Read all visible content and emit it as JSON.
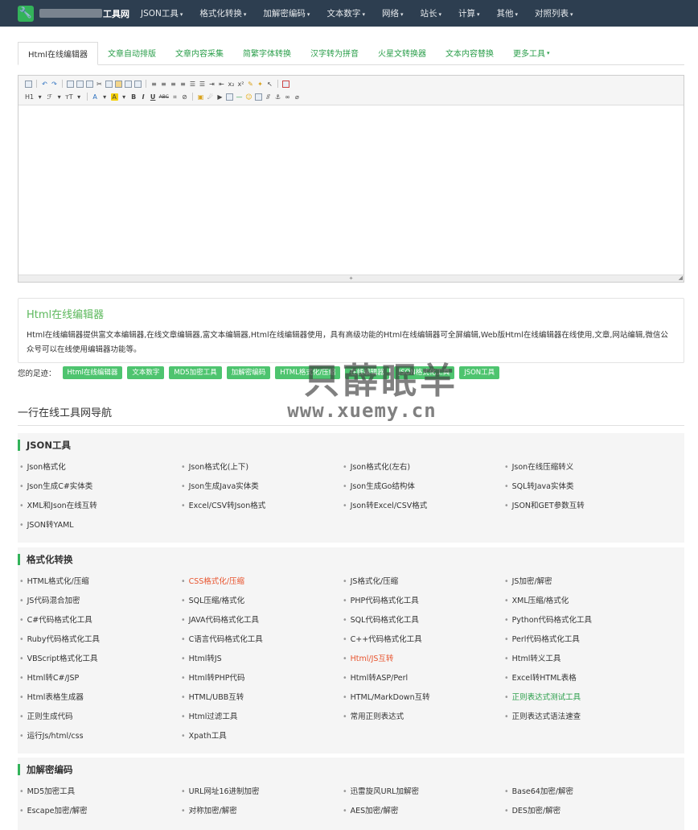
{
  "topnav": {
    "logo_icon": "wrench-icon",
    "site_name": "工具网",
    "items": [
      {
        "label": "JSON工具"
      },
      {
        "label": "格式化转换"
      },
      {
        "label": "加解密编码"
      },
      {
        "label": "文本数字"
      },
      {
        "label": "网络"
      },
      {
        "label": "站长"
      },
      {
        "label": "计算"
      },
      {
        "label": "其他"
      },
      {
        "label": "对照列表"
      }
    ]
  },
  "tabs": [
    {
      "label": "Html在线编辑器",
      "active": true
    },
    {
      "label": "文章自动排版"
    },
    {
      "label": "文章内容采集"
    },
    {
      "label": "简繁字体转换"
    },
    {
      "label": "汉字转为拼音"
    },
    {
      "label": "火星文转换器"
    },
    {
      "label": "文本内容替换"
    },
    {
      "label": "更多工具"
    }
  ],
  "editor": {
    "toolbar_row2_labels": {
      "heading": "H1",
      "font": "ℱ",
      "size": "тT",
      "bold": "B",
      "italic": "I",
      "underline": "U",
      "strike": "ABC"
    }
  },
  "description": {
    "title": "Html在线编辑器",
    "text": "Html在线编辑器提供富文本编辑器,在线文章编辑器,富文本编辑器,Html在线编辑器使用，具有高级功能的Html在线编辑器可全屏编辑,Web版Html在线编辑器在线使用,文章,网站编辑,微信公众号可以在线使用编辑器功能等。"
  },
  "footprint": {
    "label": "您的足迹：",
    "items": [
      "Html在线编辑器",
      "文本数字",
      "MD5加密工具",
      "加解密编码",
      "HTML格式化/压缩",
      "在线编辑器",
      "JSON格式化工具",
      "JSON工具"
    ]
  },
  "watermark": {
    "line1": "只薛眠羊",
    "line2": "www.xuemy.cn"
  },
  "nav_heading": "一行在线工具网导航",
  "sections": [
    {
      "title": "JSON工具",
      "items": [
        {
          "label": "Json格式化"
        },
        {
          "label": "Json格式化(上下)"
        },
        {
          "label": "Json格式化(左右)"
        },
        {
          "label": "Json在线压缩转义"
        },
        {
          "label": "Json生成C#实体类"
        },
        {
          "label": "Json生成Java实体类"
        },
        {
          "label": "Json生成Go结构体"
        },
        {
          "label": "SQL转Java实体类"
        },
        {
          "label": "XML和Json在线互转"
        },
        {
          "label": "Excel/CSV转Json格式"
        },
        {
          "label": "Json转Excel/CSV格式"
        },
        {
          "label": "JSON和GET参数互转"
        },
        {
          "label": "JSON转YAML"
        }
      ]
    },
    {
      "title": "格式化转换",
      "items": [
        {
          "label": "HTML格式化/压缩"
        },
        {
          "label": "CSS格式化/压缩",
          "color": "red"
        },
        {
          "label": "JS格式化/压缩"
        },
        {
          "label": "JS加密/解密"
        },
        {
          "label": "JS代码混合加密"
        },
        {
          "label": "SQL压缩/格式化"
        },
        {
          "label": "PHP代码格式化工具"
        },
        {
          "label": "XML压缩/格式化"
        },
        {
          "label": "C#代码格式化工具"
        },
        {
          "label": "JAVA代码格式化工具"
        },
        {
          "label": "SQL代码格式化工具"
        },
        {
          "label": "Python代码格式化工具"
        },
        {
          "label": "Ruby代码格式化工具"
        },
        {
          "label": "C语言代码格式化工具"
        },
        {
          "label": "C++代码格式化工具"
        },
        {
          "label": "Perl代码格式化工具"
        },
        {
          "label": "VBScript格式化工具"
        },
        {
          "label": "Html转JS"
        },
        {
          "label": "Html/JS互转",
          "color": "red"
        },
        {
          "label": "Html转义工具"
        },
        {
          "label": "Html转C#/JSP"
        },
        {
          "label": "Html转PHP代码"
        },
        {
          "label": "Html转ASP/Perl"
        },
        {
          "label": "Excel转HTML表格"
        },
        {
          "label": "Html表格生成器"
        },
        {
          "label": "HTML/UBB互转"
        },
        {
          "label": "HTML/MarkDown互转"
        },
        {
          "label": "正则表达式测试工具",
          "color": "green"
        },
        {
          "label": "正则生成代码"
        },
        {
          "label": "Html过滤工具"
        },
        {
          "label": "常用正则表达式"
        },
        {
          "label": "正则表达式语法速查"
        },
        {
          "label": "运行Js/html/css"
        },
        {
          "label": "Xpath工具"
        }
      ]
    },
    {
      "title": "加解密编码",
      "items": [
        {
          "label": "MD5加密工具"
        },
        {
          "label": "URL网址16进制加密"
        },
        {
          "label": "迅雷旋风URL加解密"
        },
        {
          "label": "Base64加密/解密"
        },
        {
          "label": "Escape加密/解密"
        },
        {
          "label": "对称加密/解密"
        },
        {
          "label": "AES加密/解密"
        },
        {
          "label": "DES加密/解密"
        }
      ]
    }
  ],
  "colors": {
    "nav_bg": "#2d3e50",
    "accent_green": "#33b35a",
    "link_red": "#e8542e"
  }
}
